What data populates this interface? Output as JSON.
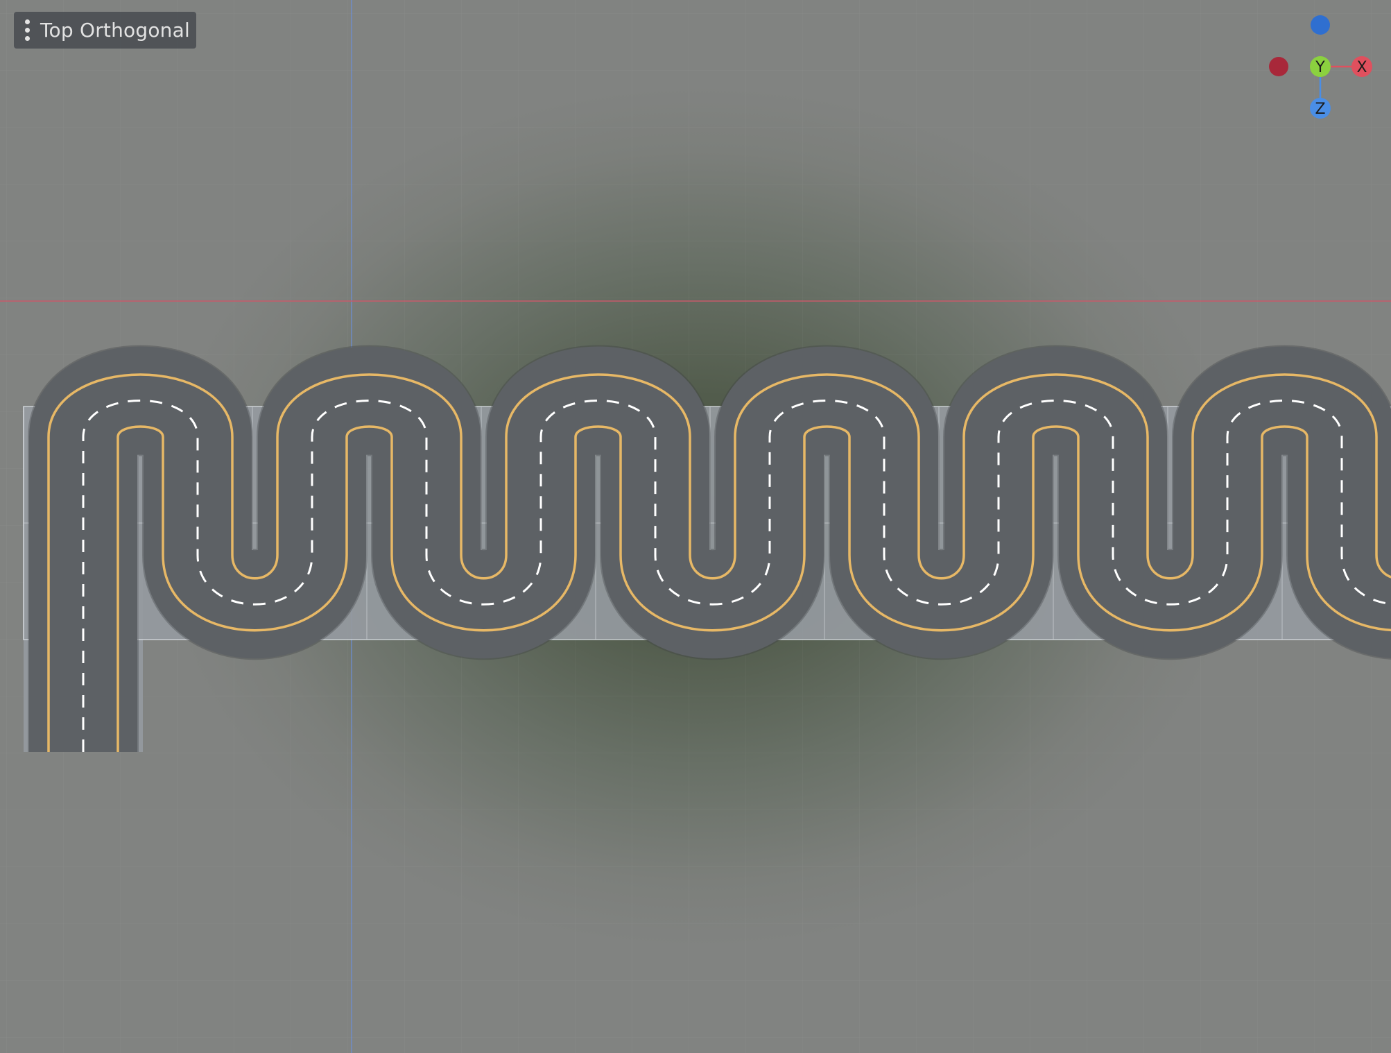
{
  "viewport": {
    "view_label": "Top Orthogonal",
    "menu_icon": "kebab-menu-icon"
  },
  "gizmo": {
    "y_label": "Y",
    "x_label": "X",
    "z_label": "Z",
    "colors": {
      "x": "#e0505e",
      "x_neg": "#a8283a",
      "y": "#8bd13f",
      "z": "#4a8ee6",
      "z_neg": "#2f6fd0"
    }
  },
  "scene": {
    "road_color": "#6f7378",
    "tile_color": "#959aa0",
    "center_line_color": "#e7b866",
    "lane_dash_color": "#ffffff",
    "x_axis_line_color": "#c85a6a",
    "z_axis_line_color": "#6d8fd8"
  }
}
